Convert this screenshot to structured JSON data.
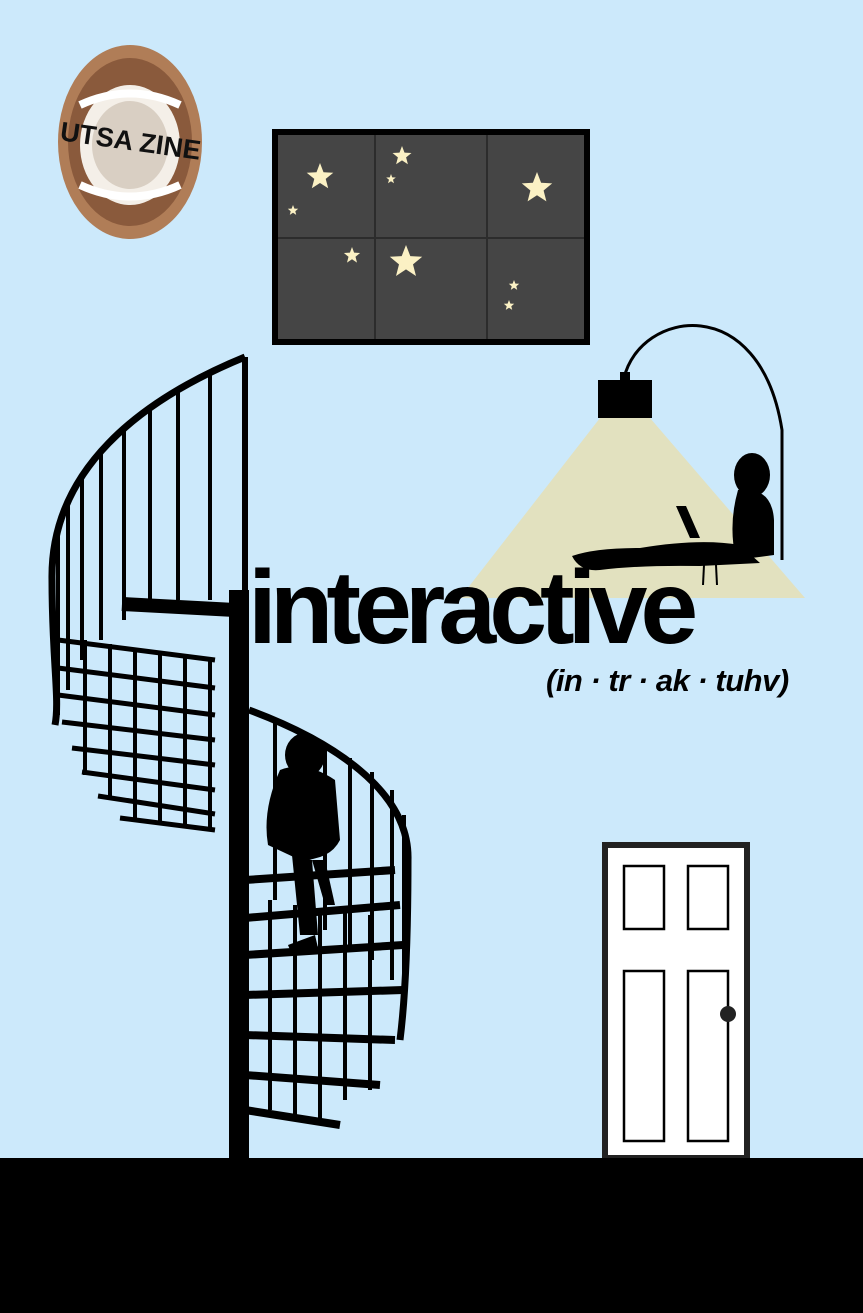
{
  "poster": {
    "title": "interactive",
    "pronunciation": "(in · tr · ak · tuhv)",
    "badge_text": "UTSA ZINE"
  },
  "colors": {
    "background": "#cce9fb",
    "night_sky": "#454545",
    "star": "#fbf1c4",
    "lamp_light": "#e2e1bf",
    "door": "#ffffff",
    "silhouette": "#000000"
  },
  "icons": {
    "badge": "mouth-icon",
    "window": "night-window-icon",
    "lamp": "arc-lamp-icon",
    "staircase": "spiral-staircase-icon",
    "door": "door-icon"
  }
}
